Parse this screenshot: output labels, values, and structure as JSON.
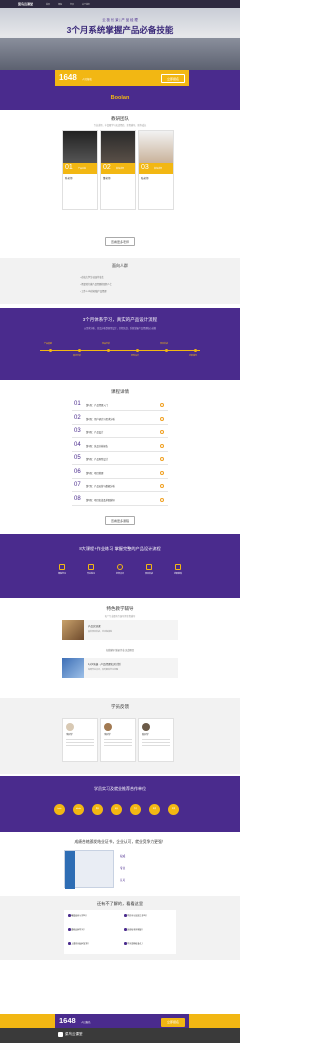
{
  "nav": {
    "logo": "菜鸟云课堂",
    "items": [
      "首页",
      "课程",
      "学员",
      "关于我们"
    ]
  },
  "hero": {
    "tag": "云 极 长 景 | 产 品 经 理",
    "title": "3个月系统掌握产品必备技能"
  },
  "enroll": {
    "count": "1648",
    "note": "人已报名",
    "button": "立即报名"
  },
  "brand": {
    "text": "Boolan"
  },
  "team": {
    "title": "教研团队",
    "subtitle": "专业讲师，丰富教学与实战经验，全程辅导，助你成长",
    "teachers": [
      {
        "num": "01",
        "role": "产品总监",
        "name": "陈老师"
      },
      {
        "num": "02",
        "role": "资深讲师",
        "name": "董老师"
      },
      {
        "num": "03",
        "role": "资深讲师",
        "name": "陆老师"
      }
    ],
    "button": "查看更多老师"
  },
  "audience": {
    "title": "面向人群",
    "items": [
      "在校大学生/应届毕业生",
      "希望转行做产品经理的职场人士",
      "工作1-2年的初级产品经理"
    ]
  },
  "path": {
    "title": "3个月体系学习，真实的产品设计流程",
    "subtitle": "从需求分析、竞品分析到原型设计，全程实战，系统掌握产品经理核心技能",
    "steps": [
      "产品基础",
      "需求分析",
      "竞品分析",
      "原型设计",
      "项目实战",
      "求职辅导"
    ]
  },
  "courses": {
    "title": "课程详情",
    "items": [
      {
        "num": "01",
        "title": "第1周：产品经理入门"
      },
      {
        "num": "02",
        "title": "第2周：用户研究与需求分析"
      },
      {
        "num": "03",
        "title": "第3周：产品设计"
      },
      {
        "num": "04",
        "title": "第4周：竞品分析报告"
      },
      {
        "num": "05",
        "title": "第5周：产品原型设计"
      },
      {
        "num": "06",
        "title": "第6周：项目管理"
      },
      {
        "num": "07",
        "title": "第7周：产品运营与数据分析"
      },
      {
        "num": "08",
        "title": "第8周：项目实战及求职辅导"
      }
    ],
    "button": "查看更多课程"
  },
  "practice": {
    "title": "8大课程+作业练习 掌握完整的产品设计流程",
    "items": [
      "课程学习",
      "作业练习",
      "老师点评",
      "项目实战",
      "求职推荐"
    ]
  },
  "features": {
    "title": "特色教学辅导",
    "subtitle": "每个专业都有专属导师全程辅导",
    "items": [
      {
        "title": "产品实训课",
        "desc": "真实项目实战，全流程演练"
      },
      {
        "title": "1对1答疑 · 产品经理实训计划",
        "desc": "每周作业点评，及时解答学习问题"
      }
    ],
    "mid": "在线辅导 答疑 作业 实战项目"
  },
  "students": {
    "title": "学员反馈",
    "items": [
      {
        "name": "李同学"
      },
      {
        "name": "李同学"
      },
      {
        "name": "陈同学"
      }
    ]
  },
  "partners": {
    "title": "学员实习及就业推荐合作单位",
    "logos": [
      "baidu",
      "alibaba",
      "腾讯",
      "网易",
      "京东",
      "新浪",
      "滴滴"
    ]
  },
  "certificate": {
    "title": "成绩合格颁发结业证书，企业认可，就业竞争力更强！",
    "points": [
      "权威",
      "专业",
      "认可"
    ]
  },
  "faq": {
    "title": "还有不了解的，看看这里",
    "items": [
      "零基础可以学吗？",
      "学完可以找到工作吗？",
      "课程如何学习？",
      "是否有老师答疑？",
      "上课时间如何安排？",
      "学习周期有多久？"
    ]
  },
  "footer": {
    "logo": "菜鸟云课堂"
  }
}
